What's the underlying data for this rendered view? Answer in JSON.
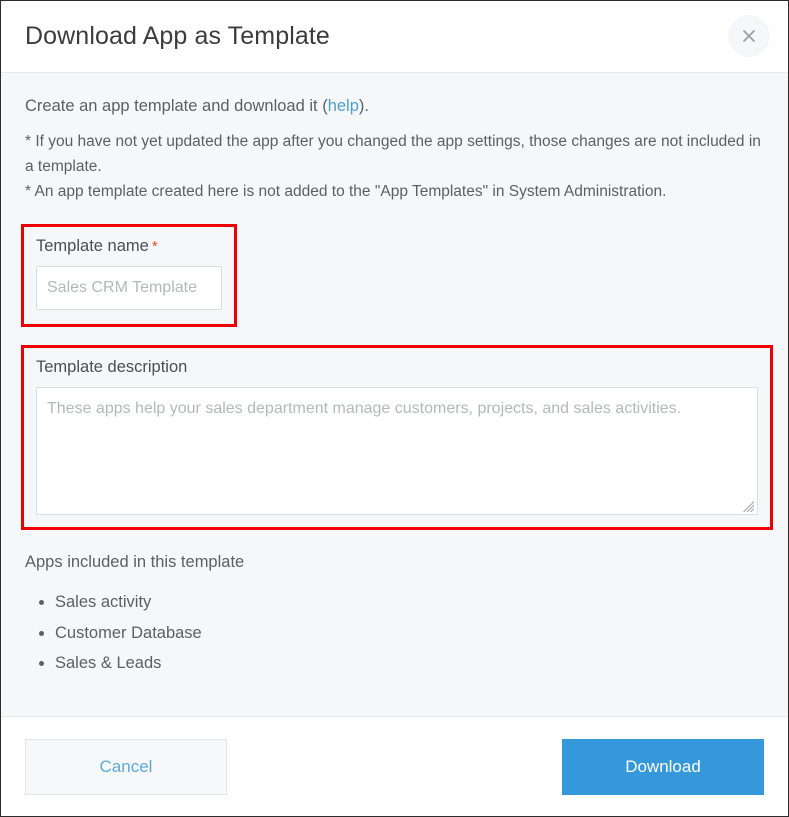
{
  "dialog": {
    "title": "Download App as Template",
    "close_icon": "close-icon"
  },
  "body": {
    "intro_prefix": "Create an app template and download it (",
    "intro_link": "help",
    "intro_suffix": ").",
    "note_1": "* If you have not yet updated the app after you changed the app settings, those changes are not included in a template.",
    "note_2": "* An app template created here is not added to the \"App Templates\" in System Administration."
  },
  "template_name": {
    "label": "Template name",
    "required_mark": "*",
    "value": "Sales CRM Template",
    "placeholder": "Sales CRM Template"
  },
  "template_description": {
    "label": "Template description",
    "value": "These apps help your sales department manage customers, projects, and sales activities.",
    "placeholder": "These apps help your sales department manage customers, projects, and sales activities."
  },
  "apps": {
    "heading": "Apps included in this template",
    "items": [
      "Sales activity",
      "Customer Database",
      "Sales & Leads"
    ]
  },
  "footer": {
    "cancel_label": "Cancel",
    "download_label": "Download"
  },
  "colors": {
    "accent_blue": "#3498db",
    "link_blue": "#4a9fd8",
    "highlight_red": "#ee0000",
    "required_red": "#e8503a",
    "body_bg": "#f6f7f9"
  }
}
